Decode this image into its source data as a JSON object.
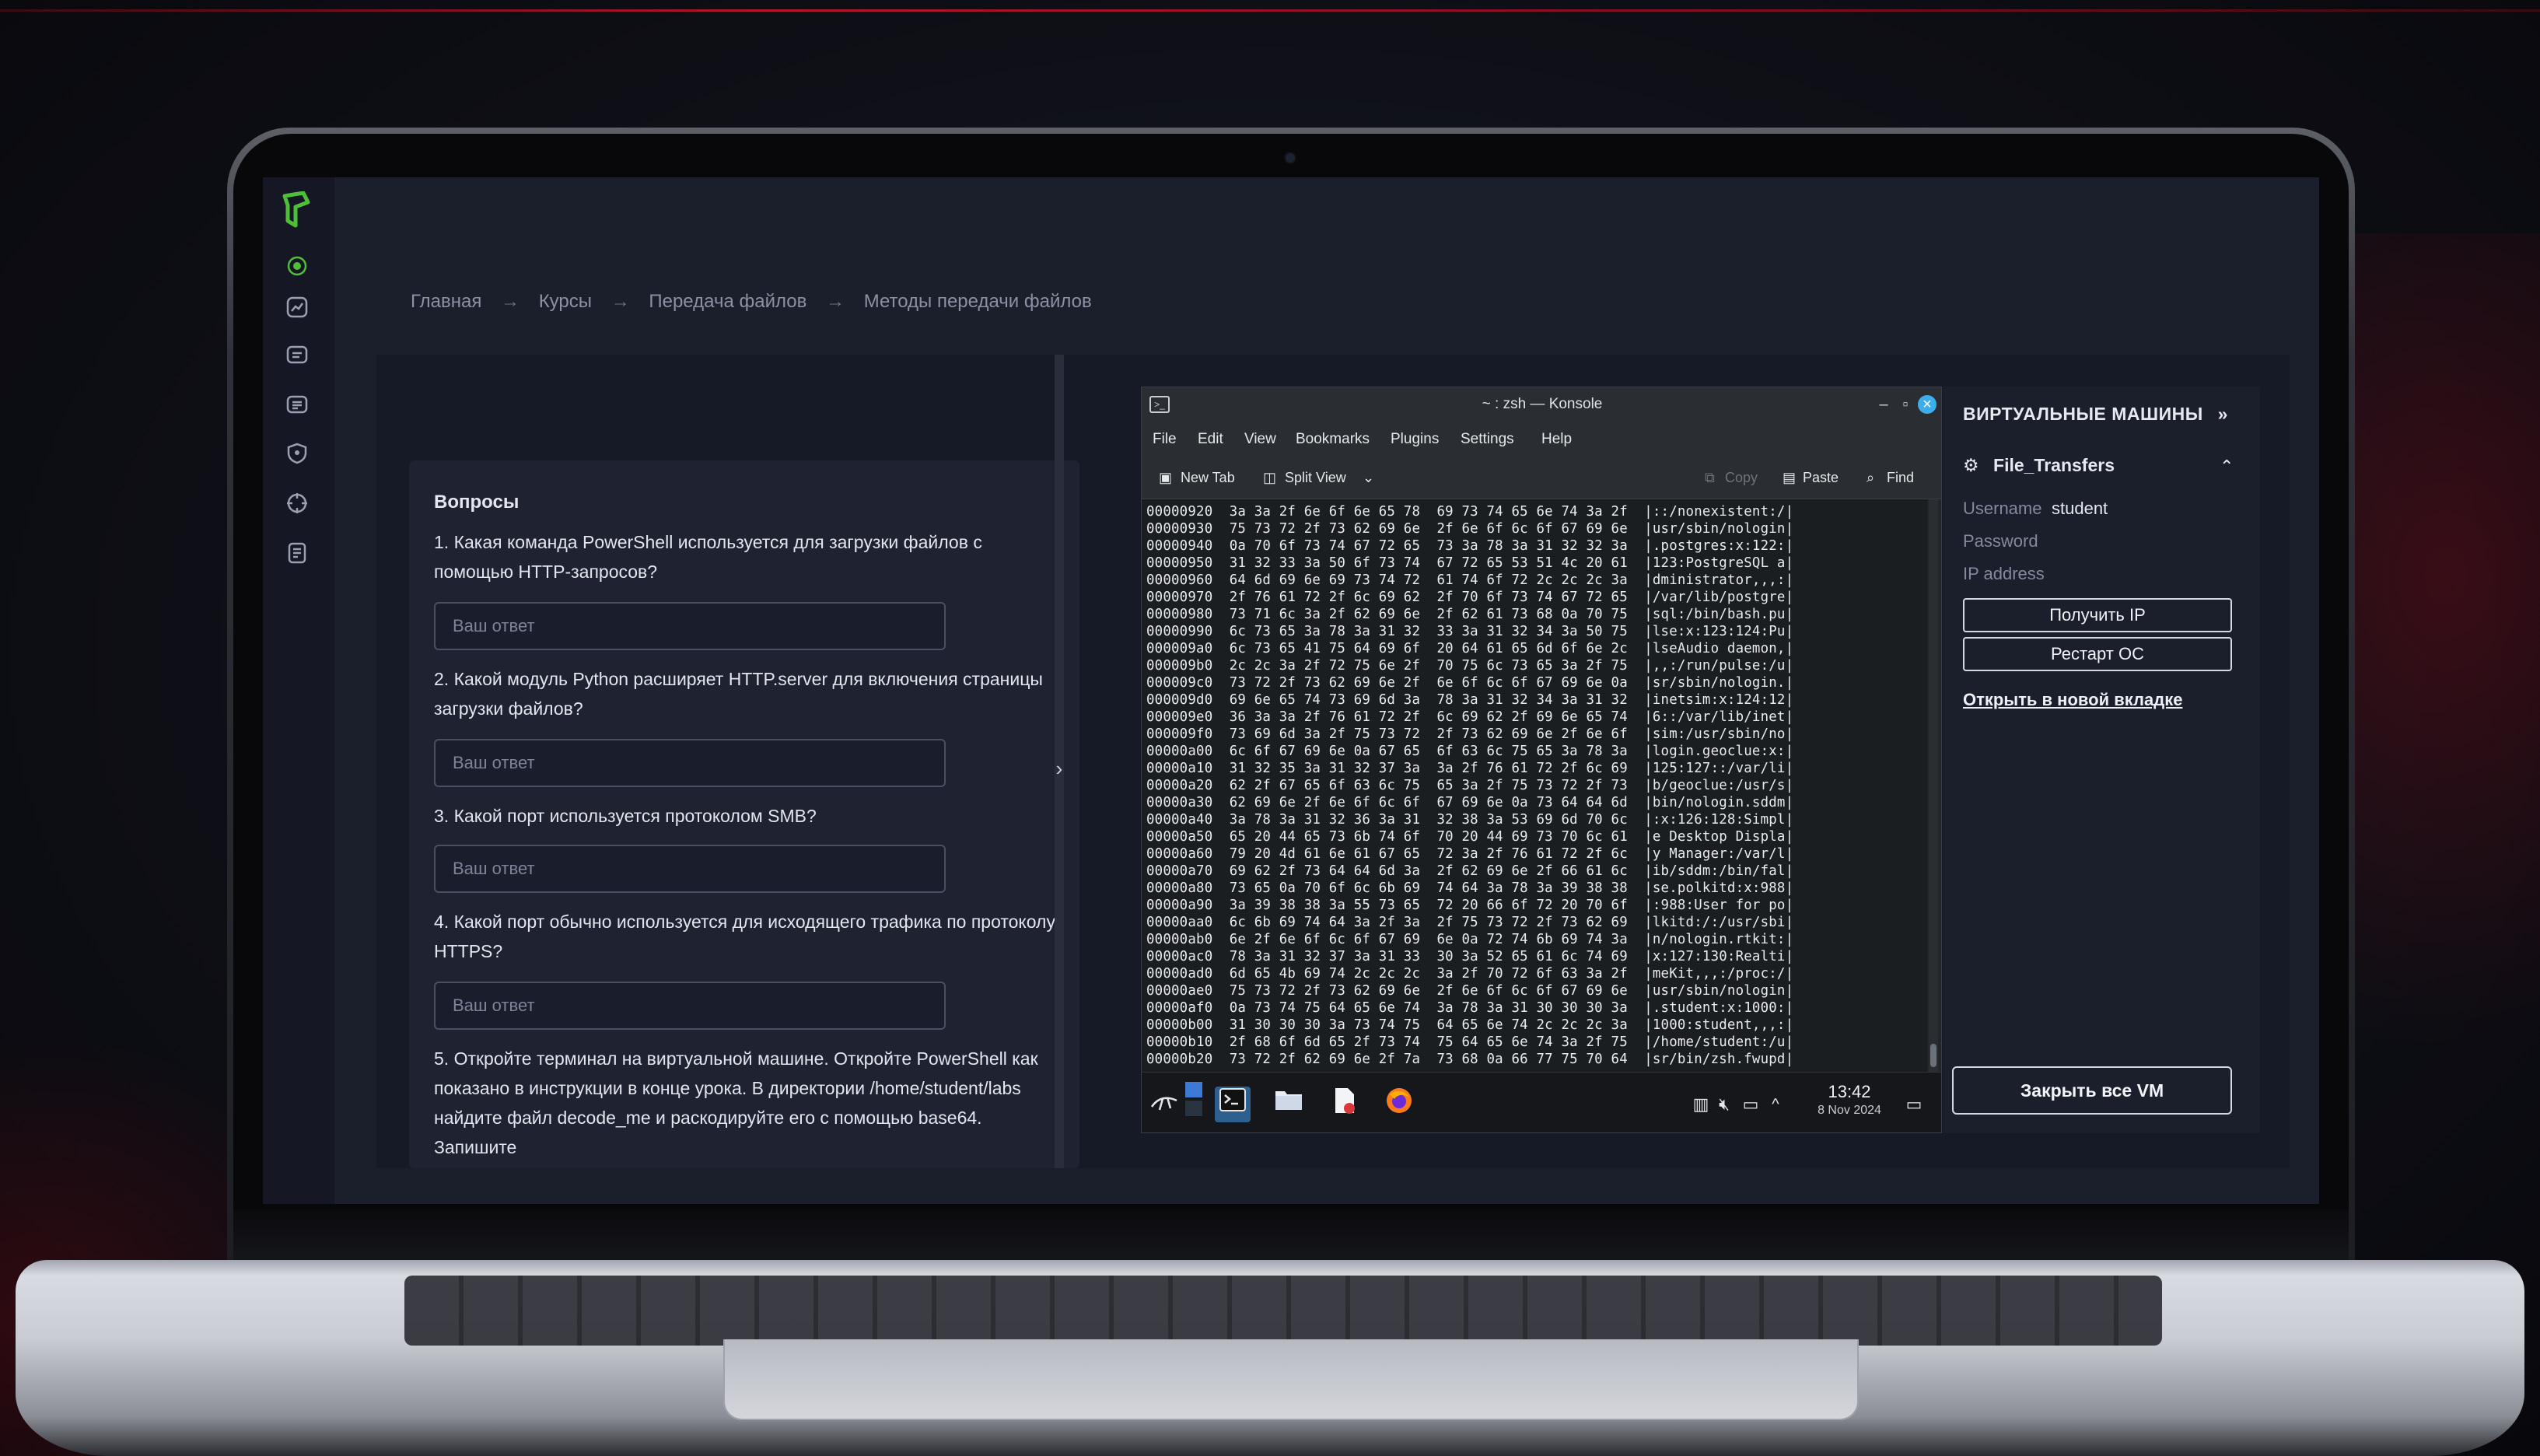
{
  "breadcrumb": [
    "Главная",
    "Курсы",
    "Передача файлов",
    "Методы передачи файлов"
  ],
  "breadcrumb_separator": "→",
  "rail_icons": [
    "target-icon",
    "chart-icon",
    "chat-icon",
    "chat-list-icon",
    "shield-icon",
    "crosshair-icon",
    "notes-icon"
  ],
  "questions": {
    "title": "Вопросы",
    "placeholder": "Ваш ответ",
    "items": [
      "1. Какая команда PowerShell используется для загрузки файлов с помощью HTTP-запросов?",
      "2. Какой модуль Python расширяет HTTP.server для включения страницы загрузки файлов?",
      "3. Какой порт используется протоколом SMB?",
      "4. Какой порт обычно используется для исходящего трафика по протоколу HTTPS?",
      "5. Откройте терминал на виртуальной машине. Откройте PowerShell как показано в инструкции в конце урока. В директории /home/student/labs найдите файл decode_me и раскодируйте его с помощью base64. Запишите"
    ]
  },
  "konsole": {
    "title": "~ : zsh — Konsole",
    "menu": [
      "File",
      "Edit",
      "View",
      "Bookmarks",
      "Plugins",
      "Settings",
      "Help"
    ],
    "toolbar": {
      "new_tab": "New Tab",
      "split_view": "Split View",
      "copy": "Copy",
      "paste": "Paste",
      "find": "Find"
    },
    "hex_lines": [
      "00000920  3a 3a 2f 6e 6f 6e 65 78  69 73 74 65 6e 74 3a 2f  |::/nonexistent:/|",
      "00000930  75 73 72 2f 73 62 69 6e  2f 6e 6f 6c 6f 67 69 6e  |usr/sbin/nologin|",
      "00000940  0a 70 6f 73 74 67 72 65  73 3a 78 3a 31 32 32 3a  |.postgres:x:122:|",
      "00000950  31 32 33 3a 50 6f 73 74  67 72 65 53 51 4c 20 61  |123:PostgreSQL a|",
      "00000960  64 6d 69 6e 69 73 74 72  61 74 6f 72 2c 2c 2c 3a  |dministrator,,,:|",
      "00000970  2f 76 61 72 2f 6c 69 62  2f 70 6f 73 74 67 72 65  |/var/lib/postgre|",
      "00000980  73 71 6c 3a 2f 62 69 6e  2f 62 61 73 68 0a 70 75  |sql:/bin/bash.pu|",
      "00000990  6c 73 65 3a 78 3a 31 32  33 3a 31 32 34 3a 50 75  |lse:x:123:124:Pu|",
      "000009a0  6c 73 65 41 75 64 69 6f  20 64 61 65 6d 6f 6e 2c  |lseAudio daemon,|",
      "000009b0  2c 2c 3a 2f 72 75 6e 2f  70 75 6c 73 65 3a 2f 75  |,,:/run/pulse:/u|",
      "000009c0  73 72 2f 73 62 69 6e 2f  6e 6f 6c 6f 67 69 6e 0a  |sr/sbin/nologin.|",
      "000009d0  69 6e 65 74 73 69 6d 3a  78 3a 31 32 34 3a 31 32  |inetsim:x:124:12|",
      "000009e0  36 3a 3a 2f 76 61 72 2f  6c 69 62 2f 69 6e 65 74  |6::/var/lib/inet|",
      "000009f0  73 69 6d 3a 2f 75 73 72  2f 73 62 69 6e 2f 6e 6f  |sim:/usr/sbin/no|",
      "00000a00  6c 6f 67 69 6e 0a 67 65  6f 63 6c 75 65 3a 78 3a  |login.geoclue:x:|",
      "00000a10  31 32 35 3a 31 32 37 3a  3a 2f 76 61 72 2f 6c 69  |125:127::/var/li|",
      "00000a20  62 2f 67 65 6f 63 6c 75  65 3a 2f 75 73 72 2f 73  |b/geoclue:/usr/s|",
      "00000a30  62 69 6e 2f 6e 6f 6c 6f  67 69 6e 0a 73 64 64 6d  |bin/nologin.sddm|",
      "00000a40  3a 78 3a 31 32 36 3a 31  32 38 3a 53 69 6d 70 6c  |:x:126:128:Simpl|",
      "00000a50  65 20 44 65 73 6b 74 6f  70 20 44 69 73 70 6c 61  |e Desktop Displa|",
      "00000a60  79 20 4d 61 6e 61 67 65  72 3a 2f 76 61 72 2f 6c  |y Manager:/var/l|",
      "00000a70  69 62 2f 73 64 64 6d 3a  2f 62 69 6e 2f 66 61 6c  |ib/sddm:/bin/fal|",
      "00000a80  73 65 0a 70 6f 6c 6b 69  74 64 3a 78 3a 39 38 38  |se.polkitd:x:988|",
      "00000a90  3a 39 38 38 3a 55 73 65  72 20 66 6f 72 20 70 6f  |:988:User for po|",
      "00000aa0  6c 6b 69 74 64 3a 2f 3a  2f 75 73 72 2f 73 62 69  |lkitd:/:/usr/sbi|",
      "00000ab0  6e 2f 6e 6f 6c 6f 67 69  6e 0a 72 74 6b 69 74 3a  |n/nologin.rtkit:|",
      "00000ac0  78 3a 31 32 37 3a 31 33  30 3a 52 65 61 6c 74 69  |x:127:130:Realti|",
      "00000ad0  6d 65 4b 69 74 2c 2c 2c  3a 2f 70 72 6f 63 3a 2f  |meKit,,,:/proc:/|",
      "00000ae0  75 73 72 2f 73 62 69 6e  2f 6e 6f 6c 6f 67 69 6e  |usr/sbin/nologin|",
      "00000af0  0a 73 74 75 64 65 6e 74  3a 78 3a 31 30 30 30 3a  |.student:x:1000:|",
      "00000b00  31 30 30 30 3a 73 74 75  64 65 6e 74 2c 2c 2c 3a  |1000:student,,,:|",
      "00000b10  2f 68 6f 6d 65 2f 73 74  75 64 65 6e 74 3a 2f 75  |/home/student:/u|",
      "00000b20  73 72 2f 62 69 6e 2f 7a  73 68 0a 66 77 75 70 64  |sr/bin/zsh.fwupd|"
    ],
    "clock": "13:42",
    "date": "8 Nov 2024"
  },
  "vm": {
    "header": "ВИРТУАЛЬНЫЕ МАШИНЫ",
    "machine": "File_Transfers",
    "username_label": "Username",
    "username": "student",
    "password_label": "Password",
    "ip_label": "IP address",
    "get_ip": "Получить IP",
    "restart": "Рестарт ОС",
    "open_tab": "Открыть в новой вкладке",
    "close_all": "Закрыть все VM"
  },
  "colors": {
    "accent_green": "#4fbf3a",
    "konsole_blue": "#3daee9",
    "background": "#1b1f2c"
  }
}
